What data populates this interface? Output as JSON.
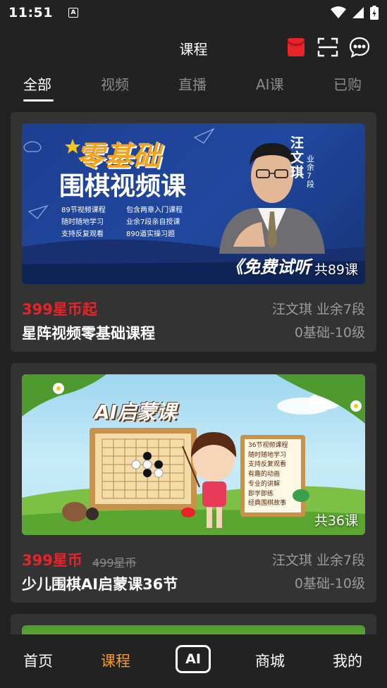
{
  "status": {
    "time": "11:51",
    "notif": "A"
  },
  "header": {
    "title": "课程"
  },
  "tabs": [
    "全部",
    "视频",
    "直播",
    "AI课",
    "已购"
  ],
  "courses": [
    {
      "banner": {
        "headline1": "零基础",
        "headline2": "围棋视频课",
        "teacher_name": "汪文琪",
        "teacher_rank": "业余7段",
        "features": [
          "89节视频课程",
          "包含两章入门课程",
          "随时随地学习",
          "业余7段亲自授课",
          "支持反复观看",
          "890道实操习题"
        ],
        "cta": "《免费试听",
        "count": "共89课"
      },
      "price": "399星币起",
      "title": "星阵视频零基础课程",
      "teacher": "汪文琪  业余7段",
      "level": "0基础-10级"
    },
    {
      "banner": {
        "headline": "AI启蒙课",
        "features": [
          "36节视频课程",
          "随时随地学习",
          "支持反复观看",
          "有趣的动画",
          "专业的讲解",
          "即学即练",
          "经典围棋故事"
        ],
        "count": "共36课"
      },
      "price": "399星币",
      "old_price": "499星币",
      "title": "少儿围棋AI启蒙课36节",
      "teacher": "汪文琪  业余7段",
      "level": "0基础-10级"
    }
  ],
  "bottom_nav": {
    "home": "首页",
    "courses": "课程",
    "ai": "AI",
    "mall": "商城",
    "mine": "我的"
  },
  "colors": {
    "accent": "#f39a2d",
    "price": "#e8242a",
    "background": "#222222",
    "card": "#333333"
  }
}
